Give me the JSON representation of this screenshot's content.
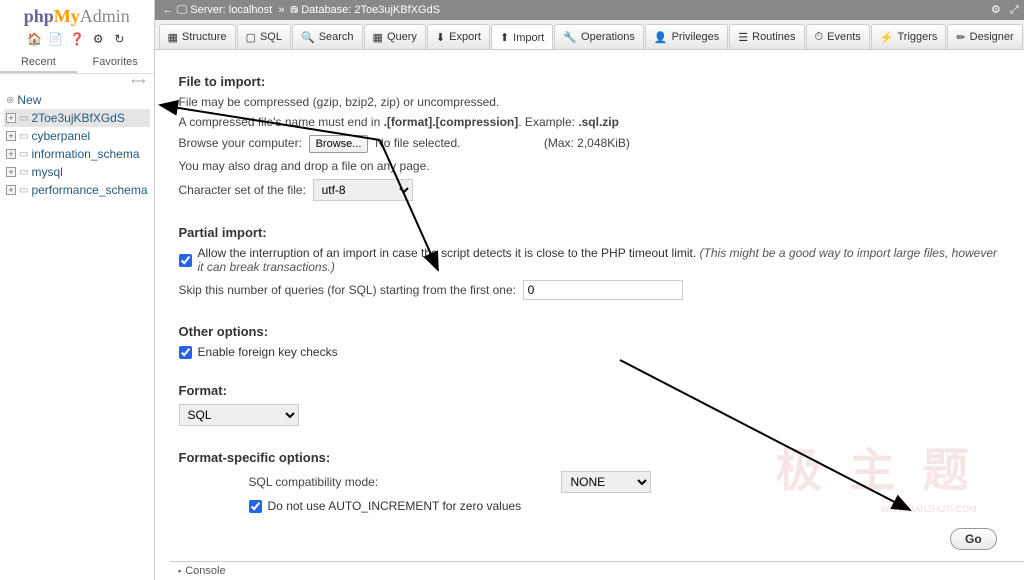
{
  "logo": {
    "php": "php",
    "my": "My",
    "admin": "Admin"
  },
  "side_tabs": {
    "recent": "Recent",
    "favorites": "Favorites"
  },
  "tree": {
    "new": "New",
    "items": [
      "2Toe3ujKBfXGdS",
      "cyberpanel",
      "information_schema",
      "mysql",
      "performance_schema"
    ]
  },
  "breadcrumb": {
    "server_label": "Server:",
    "server": "localhost",
    "db_label": "Database:",
    "db": "2Toe3ujKBfXGdS"
  },
  "tabs": {
    "structure": "Structure",
    "sql": "SQL",
    "search": "Search",
    "query": "Query",
    "export": "Export",
    "import": "Import",
    "operations": "Operations",
    "privileges": "Privileges",
    "routines": "Routines",
    "events": "Events",
    "triggers": "Triggers",
    "designer": "Designer"
  },
  "file_import": {
    "title": "File to import:",
    "compressed": "File may be compressed (gzip, bzip2, zip) or uncompressed.",
    "must_end_pre": "A compressed file's name must end in ",
    "must_end_fmt": ".[format].[compression]",
    "must_end_ex_lbl": ". Example: ",
    "must_end_ex": ".sql.zip",
    "browse_label": "Browse your computer:",
    "browse_btn": "Browse...",
    "no_file": "No file selected.",
    "max": "(Max: 2,048KiB)",
    "drag": "You may also drag and drop a file on any page.",
    "charset_label": "Character set of the file:",
    "charset": "utf-8"
  },
  "partial": {
    "title": "Partial import:",
    "allow": "Allow the interruption of an import in case the script detects it is close to the PHP timeout limit.",
    "allow_note": "(This might be a good way to import large files, however it can break transactions.)",
    "skip_label": "Skip this number of queries (for SQL) starting from the first one:",
    "skip_value": "0"
  },
  "other": {
    "title": "Other options:",
    "fk": "Enable foreign key checks"
  },
  "format": {
    "title": "Format:",
    "value": "SQL"
  },
  "format_opts": {
    "title": "Format-specific options:",
    "compat_label": "SQL compatibility mode:",
    "compat": "NONE",
    "noauto": "Do not use AUTO_INCREMENT for zero values"
  },
  "go": "Go",
  "console": "Console",
  "watermark": "极 主 题",
  "watermark_url": "WWW.BANZHUTI.COM"
}
